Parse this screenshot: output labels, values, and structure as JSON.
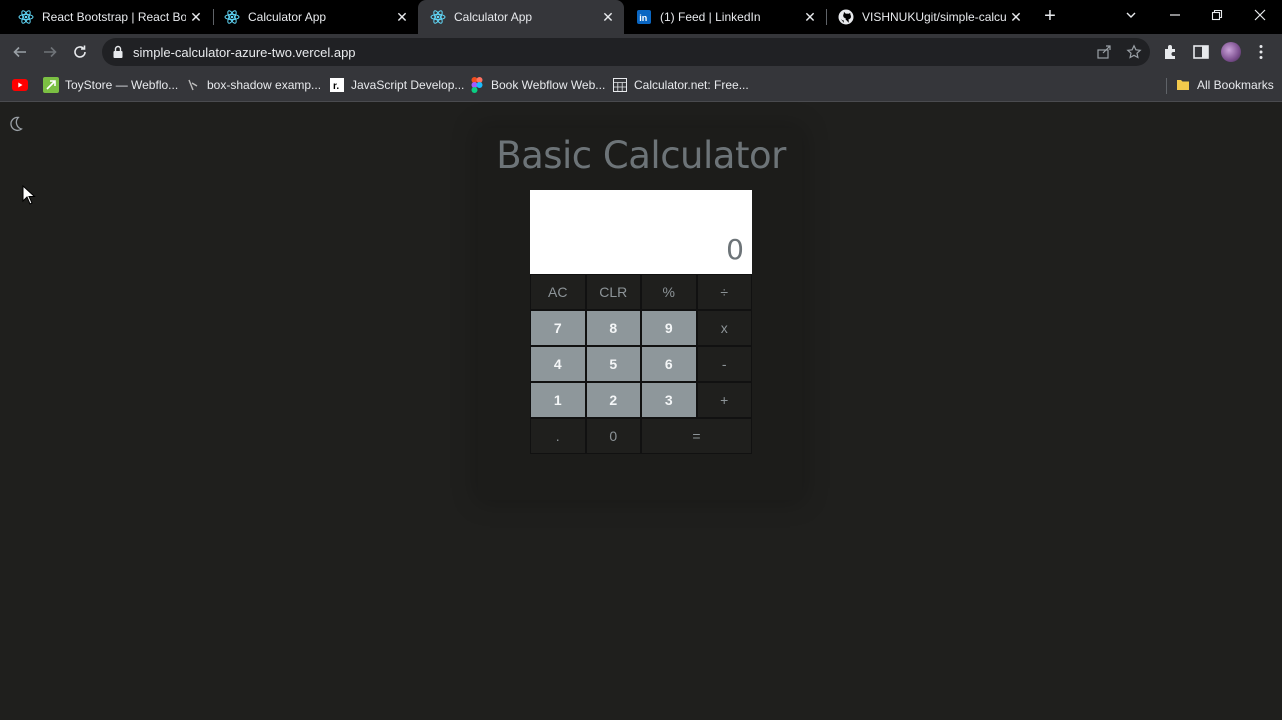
{
  "browser": {
    "tabs": [
      {
        "title": "React Bootstrap | React Boot",
        "icon": "react-icon",
        "active": false
      },
      {
        "title": "Calculator App",
        "icon": "react-icon",
        "active": false
      },
      {
        "title": "Calculator App",
        "icon": "react-icon",
        "active": true
      },
      {
        "title": "(1) Feed | LinkedIn",
        "icon": "linkedin-icon",
        "active": false
      },
      {
        "title": "VISHNUKUgit/simple-calcul",
        "icon": "github-icon",
        "active": false
      }
    ],
    "url": "simple-calculator-azure-two.vercel.app",
    "bookmarks": [
      {
        "label": "",
        "icon": "youtube-icon"
      },
      {
        "label": "ToyStore — Webflo...",
        "icon": "webflow-icon"
      },
      {
        "label": "box-shadow examp...",
        "icon": "shadow-icon"
      },
      {
        "label": "JavaScript Develop...",
        "icon": "r-icon"
      },
      {
        "label": "Book Webflow Web...",
        "icon": "figma-icon"
      },
      {
        "label": "Calculator.net: Free...",
        "icon": "calculator-icon"
      }
    ],
    "all_bookmarks_label": "All Bookmarks"
  },
  "page": {
    "title": "Basic Calculator",
    "display_value": "0",
    "keys": [
      {
        "label": "AC",
        "kind": "op"
      },
      {
        "label": "CLR",
        "kind": "op"
      },
      {
        "label": "%",
        "kind": "op"
      },
      {
        "label": "÷",
        "kind": "op"
      },
      {
        "label": "7",
        "kind": "num"
      },
      {
        "label": "8",
        "kind": "num"
      },
      {
        "label": "9",
        "kind": "num"
      },
      {
        "label": "x",
        "kind": "op"
      },
      {
        "label": "4",
        "kind": "num"
      },
      {
        "label": "5",
        "kind": "num"
      },
      {
        "label": "6",
        "kind": "num"
      },
      {
        "label": "-",
        "kind": "op"
      },
      {
        "label": "1",
        "kind": "num"
      },
      {
        "label": "2",
        "kind": "num"
      },
      {
        "label": "3",
        "kind": "num"
      },
      {
        "label": "+",
        "kind": "op"
      },
      {
        "label": ".",
        "kind": "op"
      },
      {
        "label": "0",
        "kind": "op"
      },
      {
        "label": "=",
        "kind": "op"
      }
    ]
  },
  "colors": {
    "page_bg": "#1f1f1d",
    "number_key_bg": "#8e979b",
    "title_text": "#6d7478",
    "display_bg": "#ffffff"
  }
}
